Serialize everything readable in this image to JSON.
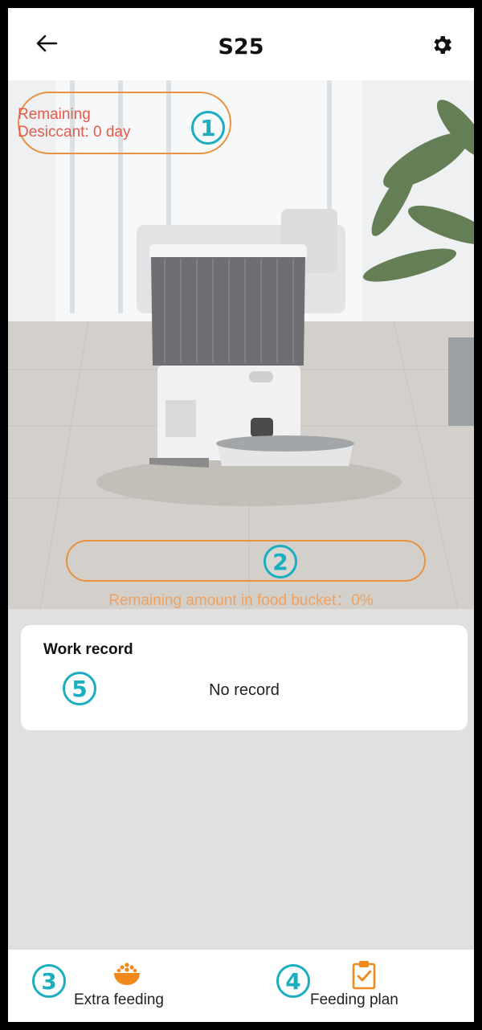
{
  "header": {
    "title": "S25",
    "back_icon": "back-arrow-icon",
    "settings_icon": "gear-icon"
  },
  "hero": {
    "desiccant_line1": "Remaining",
    "desiccant_line2": "Desiccant: 0 day",
    "food_label": "Remaining amount in food bucket：0%",
    "food_remaining_percent": 0
  },
  "annotations": {
    "b1": "1",
    "b2": "2",
    "b3": "3",
    "b4": "4",
    "b5": "5"
  },
  "work_record": {
    "title": "Work record",
    "empty": "No record"
  },
  "bottom": {
    "extra": {
      "label": "Extra feeding",
      "icon": "food-bowl-icon"
    },
    "plan": {
      "label": "Feeding plan",
      "icon": "clipboard-check-icon"
    }
  },
  "colors": {
    "accent_orange": "#e8913f",
    "badge_teal": "#1aaec0",
    "alert_red": "#e35b4e",
    "background": "#e2dfdf"
  }
}
